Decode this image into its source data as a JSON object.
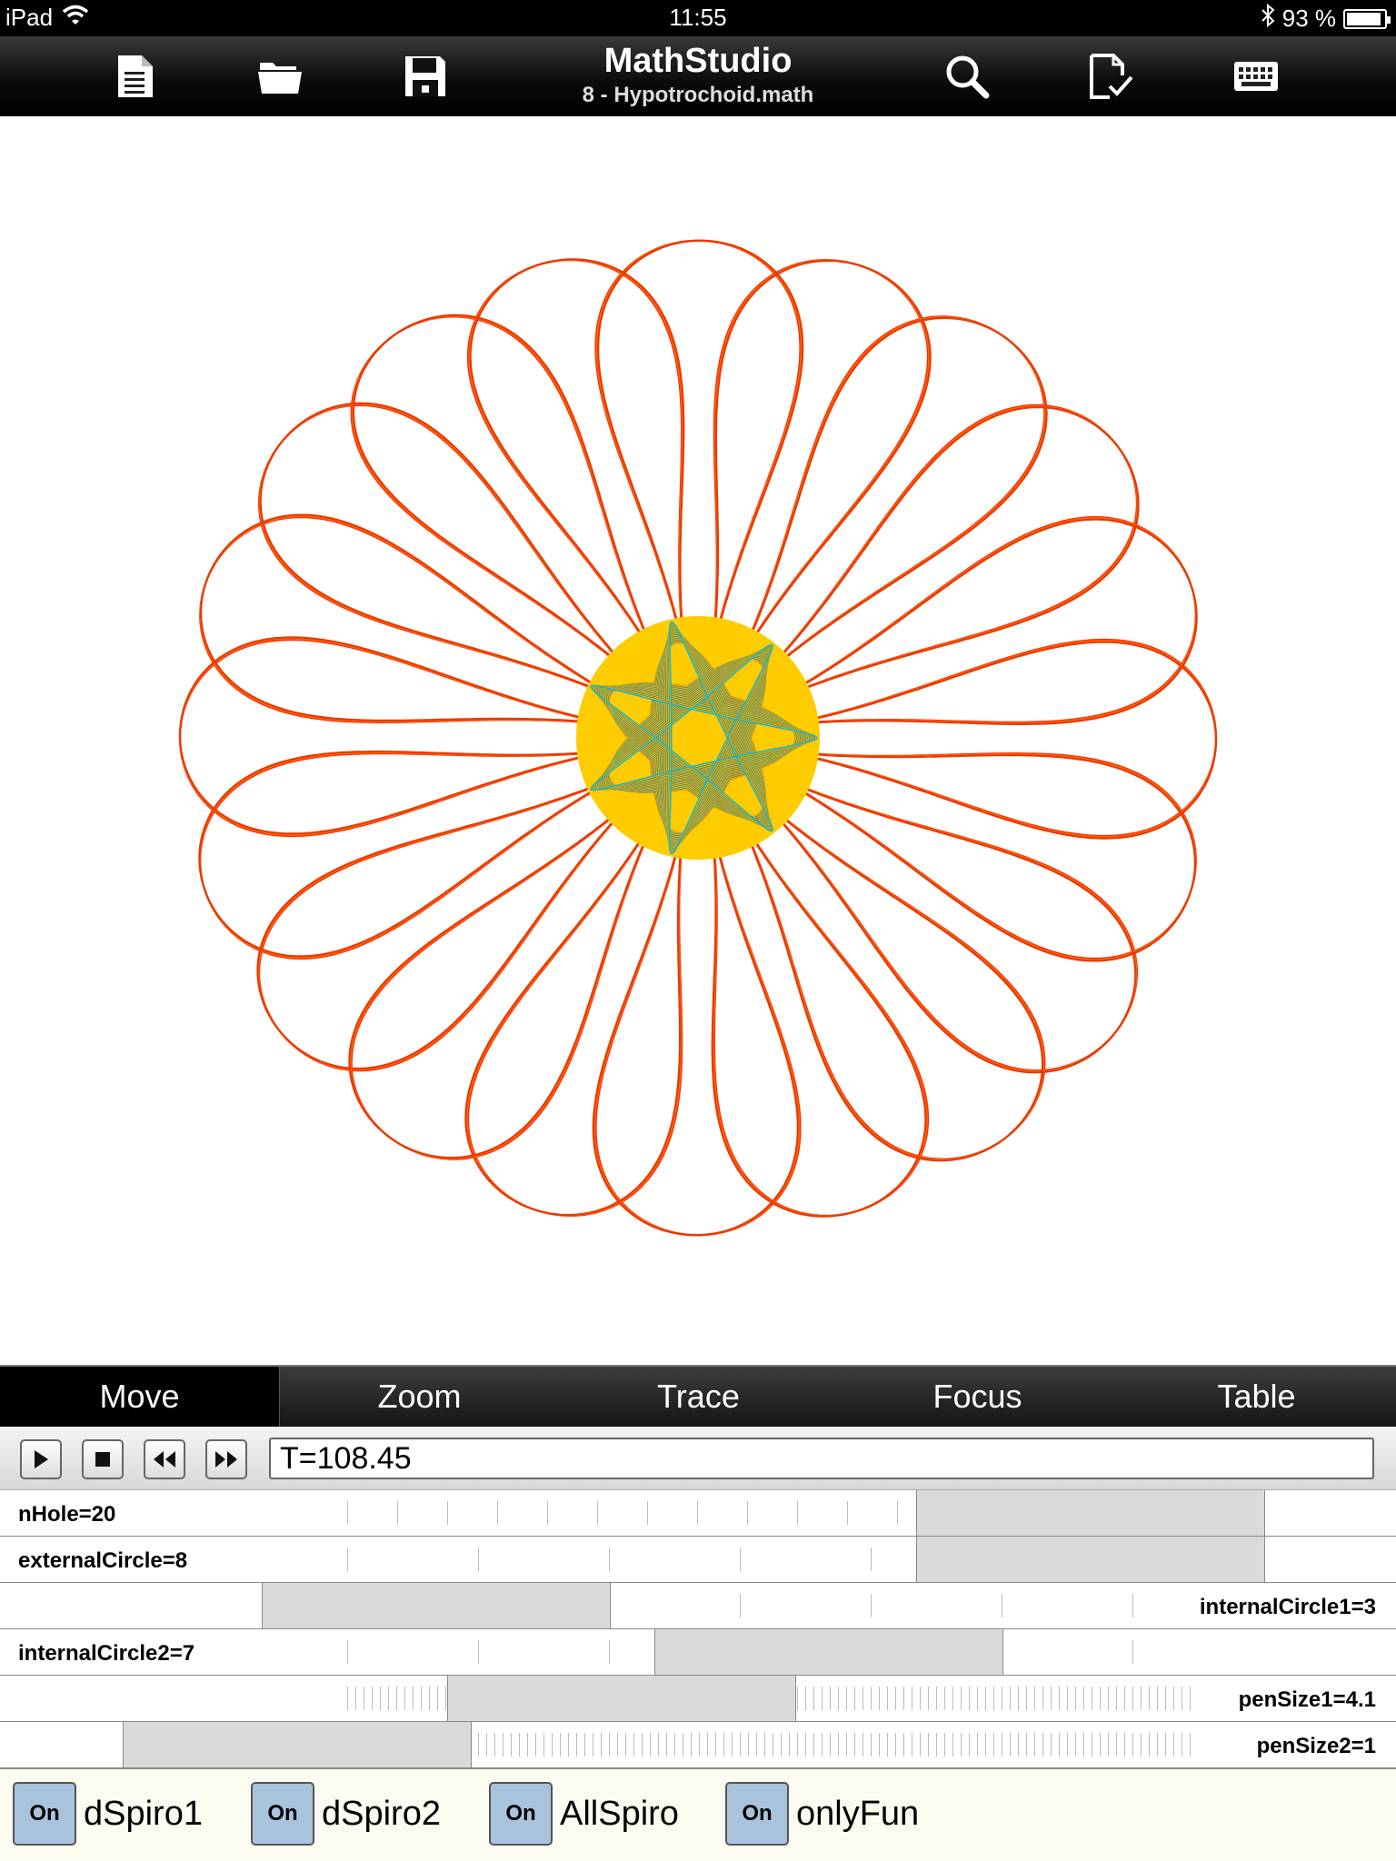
{
  "status_bar": {
    "device": "iPad",
    "time": "11:55",
    "battery": "93 %",
    "battery_level": 0.93
  },
  "toolbar": {
    "title": "MathStudio",
    "subtitle": "8 - Hypotrochoid.math",
    "buttons": [
      {
        "name": "new-document",
        "icon": "document-icon"
      },
      {
        "name": "open-folder",
        "icon": "folder-icon"
      },
      {
        "name": "save",
        "icon": "floppy-disk-icon"
      },
      {
        "name": "search",
        "icon": "magnifier-icon"
      },
      {
        "name": "check-document",
        "icon": "document-check-icon"
      },
      {
        "name": "keyboard",
        "icon": "keyboard-icon"
      }
    ]
  },
  "plot": {
    "type": "hypotrochoid-spirograph",
    "outer_petals": 20,
    "outer_color": "#ff3300",
    "inner_colors": [
      "#ff2200",
      "#ff9900",
      "#ffff00",
      "#33cc33",
      "#00aaff"
    ]
  },
  "mode_tabs": [
    {
      "label": "Move",
      "active": true
    },
    {
      "label": "Zoom",
      "active": false
    },
    {
      "label": "Trace",
      "active": false
    },
    {
      "label": "Focus",
      "active": false
    },
    {
      "label": "Table",
      "active": false
    }
  ],
  "animation": {
    "time_value": "T=108.45",
    "buttons": [
      "play-icon",
      "stop-icon",
      "rewind-icon",
      "fast-forward-icon"
    ]
  },
  "sliders": [
    {
      "label": "nHole=20",
      "label_side": "left",
      "value_fraction": 0.875
    },
    {
      "label": "externalCircle=8",
      "label_side": "left",
      "value_fraction": 0.875
    },
    {
      "label": "internalCircle1=3",
      "label_side": "right",
      "value_fraction": 0.25
    },
    {
      "label": "internalCircle2=7",
      "label_side": "left",
      "value_fraction": 0.625
    },
    {
      "label": "penSize1=4.1",
      "label_side": "right",
      "value_fraction": 0.41
    },
    {
      "label": "penSize2=1",
      "label_side": "right",
      "value_fraction": 0.1
    }
  ],
  "toggles": [
    {
      "state": "On",
      "label": "dSpiro1"
    },
    {
      "state": "On",
      "label": "dSpiro2"
    },
    {
      "state": "On",
      "label": "AllSpiro"
    },
    {
      "state": "On",
      "label": "onlyFun"
    }
  ]
}
